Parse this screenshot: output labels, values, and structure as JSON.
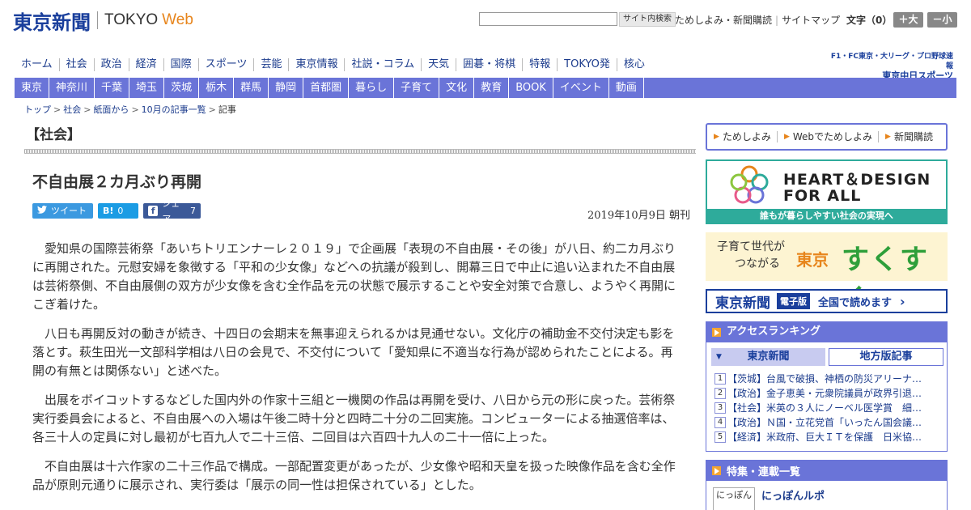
{
  "header": {
    "logo_jp": "東京新聞",
    "logo_en": "TOKYO",
    "logo_web": "Web",
    "search_button": "サイト内検索",
    "links": [
      "ためしよみ・新聞購読",
      "サイトマップ"
    ],
    "font_label": "文字（0）",
    "font_plus": "＋大",
    "font_minus": "－小"
  },
  "nav_main": [
    "ホーム",
    "社会",
    "政治",
    "経済",
    "国際",
    "スポーツ",
    "芸能",
    "東京情報",
    "社説・コラム",
    "天気",
    "囲碁・将棋",
    "特報",
    "TOKYO発",
    "核心"
  ],
  "chunichi": {
    "line1": "F1・FC東京・大リーグ・プロ野球速報",
    "line2": "東京中日スポーツ"
  },
  "nav_region": [
    "東京",
    "神奈川",
    "千葉",
    "埼玉",
    "茨城",
    "栃木",
    "群馬",
    "静岡",
    "首都圏",
    "暮らし",
    "子育て",
    "文化",
    "教育",
    "BOOK",
    "イベント",
    "動画"
  ],
  "breadcrumb": [
    "トップ",
    "社会",
    "紙面から",
    "10月の記事一覧",
    "記事"
  ],
  "article": {
    "section": "【社会】",
    "headline": "不自由展２カ月ぶり再開",
    "tweet_label": "ツイート",
    "hatena_icon": "B!",
    "hatena_count": "0",
    "fb_icon": "f",
    "fb_label": "シェア",
    "fb_count": "7",
    "date": "2019年10月9日 朝刊",
    "paragraphs": [
      "愛知県の国際芸術祭「あいちトリエンナーレ２０１９」で企画展「表現の不自由展・その後」が八日、約二カ月ぶりに再開された。元慰安婦を象徴する「平和の少女像」などへの抗議が殺到し、開幕三日で中止に追い込まれた不自由展は芸術祭側、不自由展側の双方が少女像を含む全作品を元の状態で展示することや安全対策で合意し、ようやく再開にこぎ着けた。",
      "八日も再開反対の動きが続き、十四日の会期末を無事迎えられるかは見通せない。文化庁の補助金不交付決定も影を落とす。萩生田光一文部科学相は八日の会見で、不交付について「愛知県に不適当な行為が認められたことによる。再開の有無とは関係ない」と述べた。",
      "出展をボイコットするなどした国内外の作家十三組と一機関の作品は再開を受け、八日から元の形に戻った。芸術祭実行委員会によると、不自由展への入場は午後二時十分と四時二十分の二回実施。コンピューターによる抽選倍率は、各三十人の定員に対し最初が七百九人で二十三倍、二回目は六百四十九人の二十一倍に上った。",
      "不自由展は十六作家の二十三作品で構成。一部配置変更があったが、少女像や昭和天皇を扱った映像作品を含む全作品が原則元通りに展示され、実行委は「展示の同一性は担保されている」とした。"
    ]
  },
  "sidebar": {
    "tame": [
      "ためしよみ",
      "Webでためしよみ",
      "新聞購読"
    ],
    "heart": {
      "line1": "HEART＆DESIGN",
      "line2": "FOR ALL",
      "band": "誰もが暮らしやすい社会の実現へ"
    },
    "suku": {
      "line1": "子育て世代が",
      "line2": "つながる",
      "tokyo": "東京",
      "suku": "すくすく"
    },
    "denshi": {
      "name": "東京新聞",
      "edition": "電子版",
      "read": "全国で読めます"
    },
    "ranking": {
      "title": "アクセスランキング",
      "tab1": "東京新聞",
      "tab2": "地方版記事",
      "items": [
        "【茨城】台風で破損、神栖の防災アリーナ…",
        "【政治】金子恵美・元衆院議員が政界引退…",
        "【社会】米英の３人にノーベル医学賞　細…",
        "【政治】Ｎ国・立花党首「いったん国会議…",
        "【経済】米政府、巨大ＩＴを保護　日米協…"
      ]
    },
    "features": {
      "title": "特集・連載一覧",
      "item_thumb": "にっぽん",
      "item_title": "にっぽんルポ"
    }
  }
}
